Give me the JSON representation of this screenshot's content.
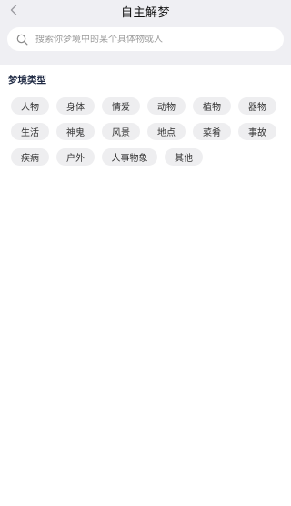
{
  "header": {
    "title": "自主解梦"
  },
  "search": {
    "placeholder": "搜索你梦境中的某个具体物或人"
  },
  "section": {
    "title": "梦境类型"
  },
  "tags": [
    [
      "人物",
      "身体",
      "情爱",
      "动物",
      "植物",
      "器物"
    ],
    [
      "生活",
      "神鬼",
      "风景",
      "地点",
      "菜肴",
      "事故"
    ],
    [
      "疾病",
      "户外",
      "人事物象",
      "其他"
    ]
  ]
}
